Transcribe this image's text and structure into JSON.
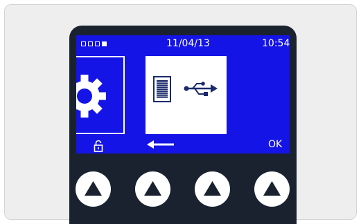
{
  "status": {
    "indicators": [
      "empty",
      "empty",
      "empty",
      "filled"
    ],
    "date": "11/04/13",
    "time": "10:54"
  },
  "tiles": {
    "previous_icon": "gear-icon",
    "current_icons": [
      "document-icon",
      "usb-icon"
    ]
  },
  "softkeys": {
    "left_icon": "padlock-icon",
    "back_icon": "back-arrow-icon",
    "ok_label": "OK"
  },
  "buttons": [
    {
      "icon": "up-triangle-icon"
    },
    {
      "icon": "up-triangle-icon"
    },
    {
      "icon": "up-triangle-icon"
    },
    {
      "icon": "up-triangle-icon"
    }
  ],
  "colors": {
    "screen": "#1414e6",
    "bezel": "#1a2230",
    "panel": "#eeeeee",
    "foreground": "#ffffff"
  }
}
